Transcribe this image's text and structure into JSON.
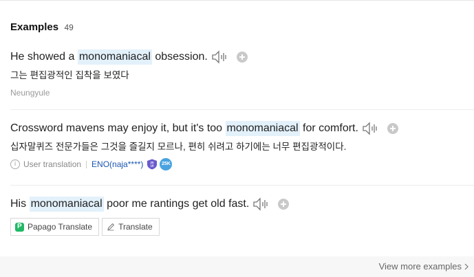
{
  "section": {
    "title": "Examples",
    "count": "49"
  },
  "examples": [
    {
      "before": "He showed a ",
      "highlight": "monomaniacal",
      "after": " obsession.",
      "translation": "그는 편집광적인 집착을 보였다",
      "source": "Neungyule"
    },
    {
      "before": "Crossword mavens may enjoy it, but it's too ",
      "highlight": "monomaniacal",
      "after": " for comfort.",
      "translation": "십자말퀴즈 전문가들은 그것을 즐길지 모르나, 편히 쉬려고 하기에는 너무 편집광적이다.",
      "user_translation_label": "User translation",
      "user": "ENO(naja****)",
      "badge_shield_text": "2018",
      "badge_count": "25K"
    },
    {
      "before": "His ",
      "highlight": "monomaniacal",
      "after": " poor me rantings get old fast.",
      "buttons": {
        "papago": "Papago Translate",
        "translate": "Translate"
      }
    }
  ],
  "footer": {
    "more_label": "View more examples"
  },
  "colors": {
    "highlight": "#e3f1fb",
    "link": "#1a55b0",
    "papago": "#21b866"
  }
}
